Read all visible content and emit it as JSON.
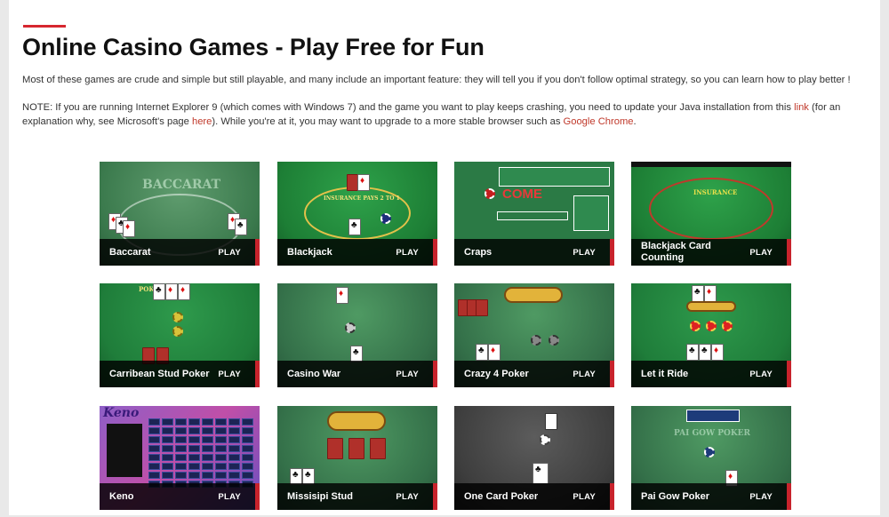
{
  "page": {
    "title": "Online Casino Games - Play Free for Fun",
    "intro": "Most of these games are crude and simple but still playable, and many include an important feature: they will tell you if you don't follow optimal strategy, so you can learn how to play better !",
    "note": {
      "part1": "NOTE: If you are running Internet Explorer 9 (which comes with Windows 7) and the game you want to play keeps crashing, you need to update your Java installation from this ",
      "link1": "link",
      "part2": " (for an explanation why, see Microsoft's page ",
      "link2": "here",
      "part3": "). While you're at it, you may want to upgrade to a more stable browser such as ",
      "link3": "Google Chrome",
      "part4": "."
    }
  },
  "games": [
    {
      "name": "Baccarat",
      "play": "PLAY",
      "felt_text": "BACCARAT"
    },
    {
      "name": "Blackjack",
      "play": "PLAY",
      "felt_text": "INSURANCE PAYS 2 TO 1"
    },
    {
      "name": "Craps",
      "play": "PLAY",
      "felt_text": "COME"
    },
    {
      "name": "Blackjack Card Counting",
      "play": "PLAY",
      "felt_text": "INSURANCE"
    },
    {
      "name": "Carribean Stud Poker",
      "play": "PLAY",
      "felt_text": "POKER"
    },
    {
      "name": "Casino War",
      "play": "PLAY",
      "felt_text": ""
    },
    {
      "name": "Crazy 4 Poker",
      "play": "PLAY",
      "felt_text": ""
    },
    {
      "name": "Let it Ride",
      "play": "PLAY",
      "felt_text": ""
    },
    {
      "name": "Keno",
      "play": "PLAY",
      "felt_text": "Keno"
    },
    {
      "name": "Missisipi Stud",
      "play": "PLAY",
      "felt_text": ""
    },
    {
      "name": "One Card Poker",
      "play": "PLAY",
      "felt_text": ""
    },
    {
      "name": "Pai Gow Poker",
      "play": "PLAY",
      "felt_text": "PAI GOW POKER"
    }
  ],
  "colors": {
    "accent": "#d6262f",
    "link": "#c0392b",
    "felt": "#2f6b41",
    "overlay": "#000000"
  }
}
